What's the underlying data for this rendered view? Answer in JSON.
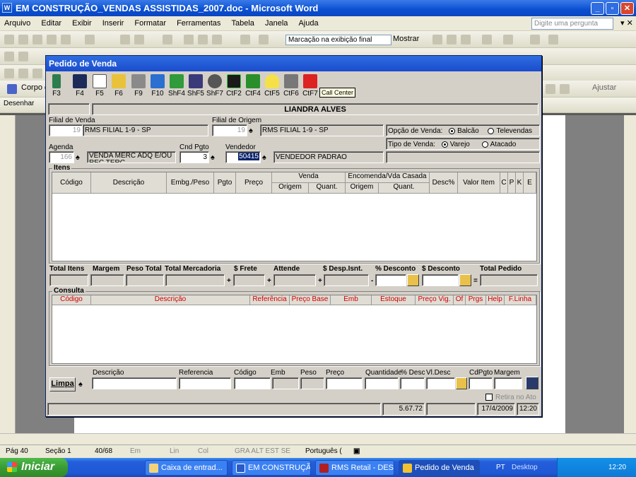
{
  "word": {
    "title": "EM CONSTRUÇÃO_VENDAS ASSISTIDAS_2007.doc - Microsoft Word",
    "menu": [
      "Arquivo",
      "Editar",
      "Exibir",
      "Inserir",
      "Formatar",
      "Ferramentas",
      "Tabela",
      "Janela",
      "Ajuda"
    ],
    "help_placeholder": "Digite uma pergunta",
    "markup_dropdown": "Marcação na exibição final",
    "show_label": "Mostrar",
    "style_label": "Corpo d",
    "draw_label": "Desenhar",
    "fit_label": "Ajustar",
    "status": {
      "page": "Pág 40",
      "section": "Seção 1",
      "pages": "40/68",
      "at": "Em",
      "line": "Lin",
      "col": "Col",
      "modes": "GRA  ALT  EST  SE",
      "lang": "Português ("
    }
  },
  "taskbar": {
    "start": "Iniciar",
    "tasks": [
      "Caixa de entrad...",
      "EM CONSTRUÇÃ...",
      "RMS Retail - DES...",
      "Pedido de Venda"
    ],
    "lang": "PT",
    "desktop": "Desktop",
    "clock": "12:20"
  },
  "dialog": {
    "title": "Pedido de Venda",
    "fkeys": [
      "F3",
      "F4",
      "F5",
      "F6",
      "F9",
      "F10",
      "ShF4",
      "ShF5",
      "ShF7",
      "CtF2",
      "CtF4",
      "CtF5",
      "CtF6",
      "CtF7"
    ],
    "tooltip": "Call Center",
    "customer_name": "LIANDRA ALVES",
    "filial_venda_label": "Filial de Venda",
    "filial_venda_code": "19",
    "filial_venda_name": "RMS FILIAL 1-9 - SP",
    "filial_origem_label": "Filial de Origem",
    "filial_origem_code": "19",
    "filial_origem_name": "RMS FILIAL 1-9 - SP",
    "opcao_venda_label": "Opção de Venda:",
    "opcao_options": [
      "Balcão",
      "Televendas"
    ],
    "tipo_venda_label": "Tipo de Venda:",
    "tipo_options": [
      "Varejo",
      "Atacado"
    ],
    "agenda_label": "Agenda",
    "agenda_code": "166",
    "agenda_desc": "VENDA MERC ADQ E/OU REC TERC",
    "cnd_pgto_label": "Cnd Pgto",
    "cnd_pgto_value": "3",
    "vendedor_label": "Vendedor",
    "vendedor_code": "50415",
    "vendedor_name": "VENDEDOR PADRAO",
    "itens_title": "Itens",
    "itens_headers": {
      "codigo": "Código",
      "descricao": "Descrição",
      "embg": "Embg./Peso",
      "pgto": "Pgto",
      "preco": "Preço",
      "venda": "Venda",
      "venda_origem": "Origem",
      "venda_quant": "Quant.",
      "encomenda": "Encomenda/Vda Casada",
      "enc_origem": "Origem",
      "enc_quant": "Quant.",
      "desc": "Desc%",
      "valor": "Valor Item",
      "c": "C",
      "p": "P",
      "k": "K",
      "e": "E"
    },
    "totals_labels": [
      "Total Itens",
      "Margem",
      "Peso Total",
      "Total Mercadoria",
      "$ Frete",
      "Attende",
      "$ Desp.Isnt.",
      "% Desconto",
      "$ Desconto",
      "Total Pedido"
    ],
    "consulta_title": "Consulta",
    "consulta_headers": [
      "Código",
      "Descrição",
      "Referência",
      "Preço Base",
      "Emb",
      "Estoque",
      "Preço Vig.",
      "Of",
      "Prgs",
      "Help",
      "F.Linha"
    ],
    "search_labels": [
      "Descrição",
      "Referencia",
      "Código",
      "Emb",
      "Peso",
      "Preço",
      "Quantidade",
      "% Desc",
      "Vl.Desc",
      "CdPgto",
      "Margem"
    ],
    "limpa_label": "Limpa",
    "retira_label": "Retira no Ato",
    "status_version": "5.67.72",
    "status_date": "17/4/2009",
    "status_time": "12:20",
    "colors": {
      "title_bar": "#1a4ccd",
      "header_red": "#d00000",
      "selected": "#0a246a"
    }
  }
}
